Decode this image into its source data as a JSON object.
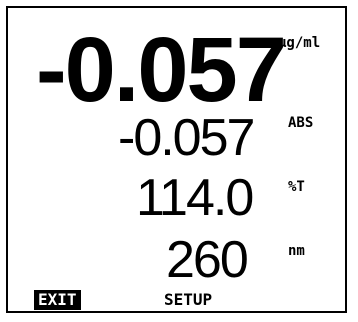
{
  "display": {
    "concentration": {
      "value": "-0.057",
      "unit": "µg/ml"
    },
    "absorbance": {
      "value": "-0.057",
      "unit": "ABS"
    },
    "transmittance": {
      "value": "114.0",
      "unit": "%T"
    },
    "wavelength": {
      "value": "260",
      "unit": "nm"
    }
  },
  "softkeys": {
    "exit_label": "EXIT",
    "setup_label": "SETUP",
    "exit_highlight_color": "#000000"
  }
}
